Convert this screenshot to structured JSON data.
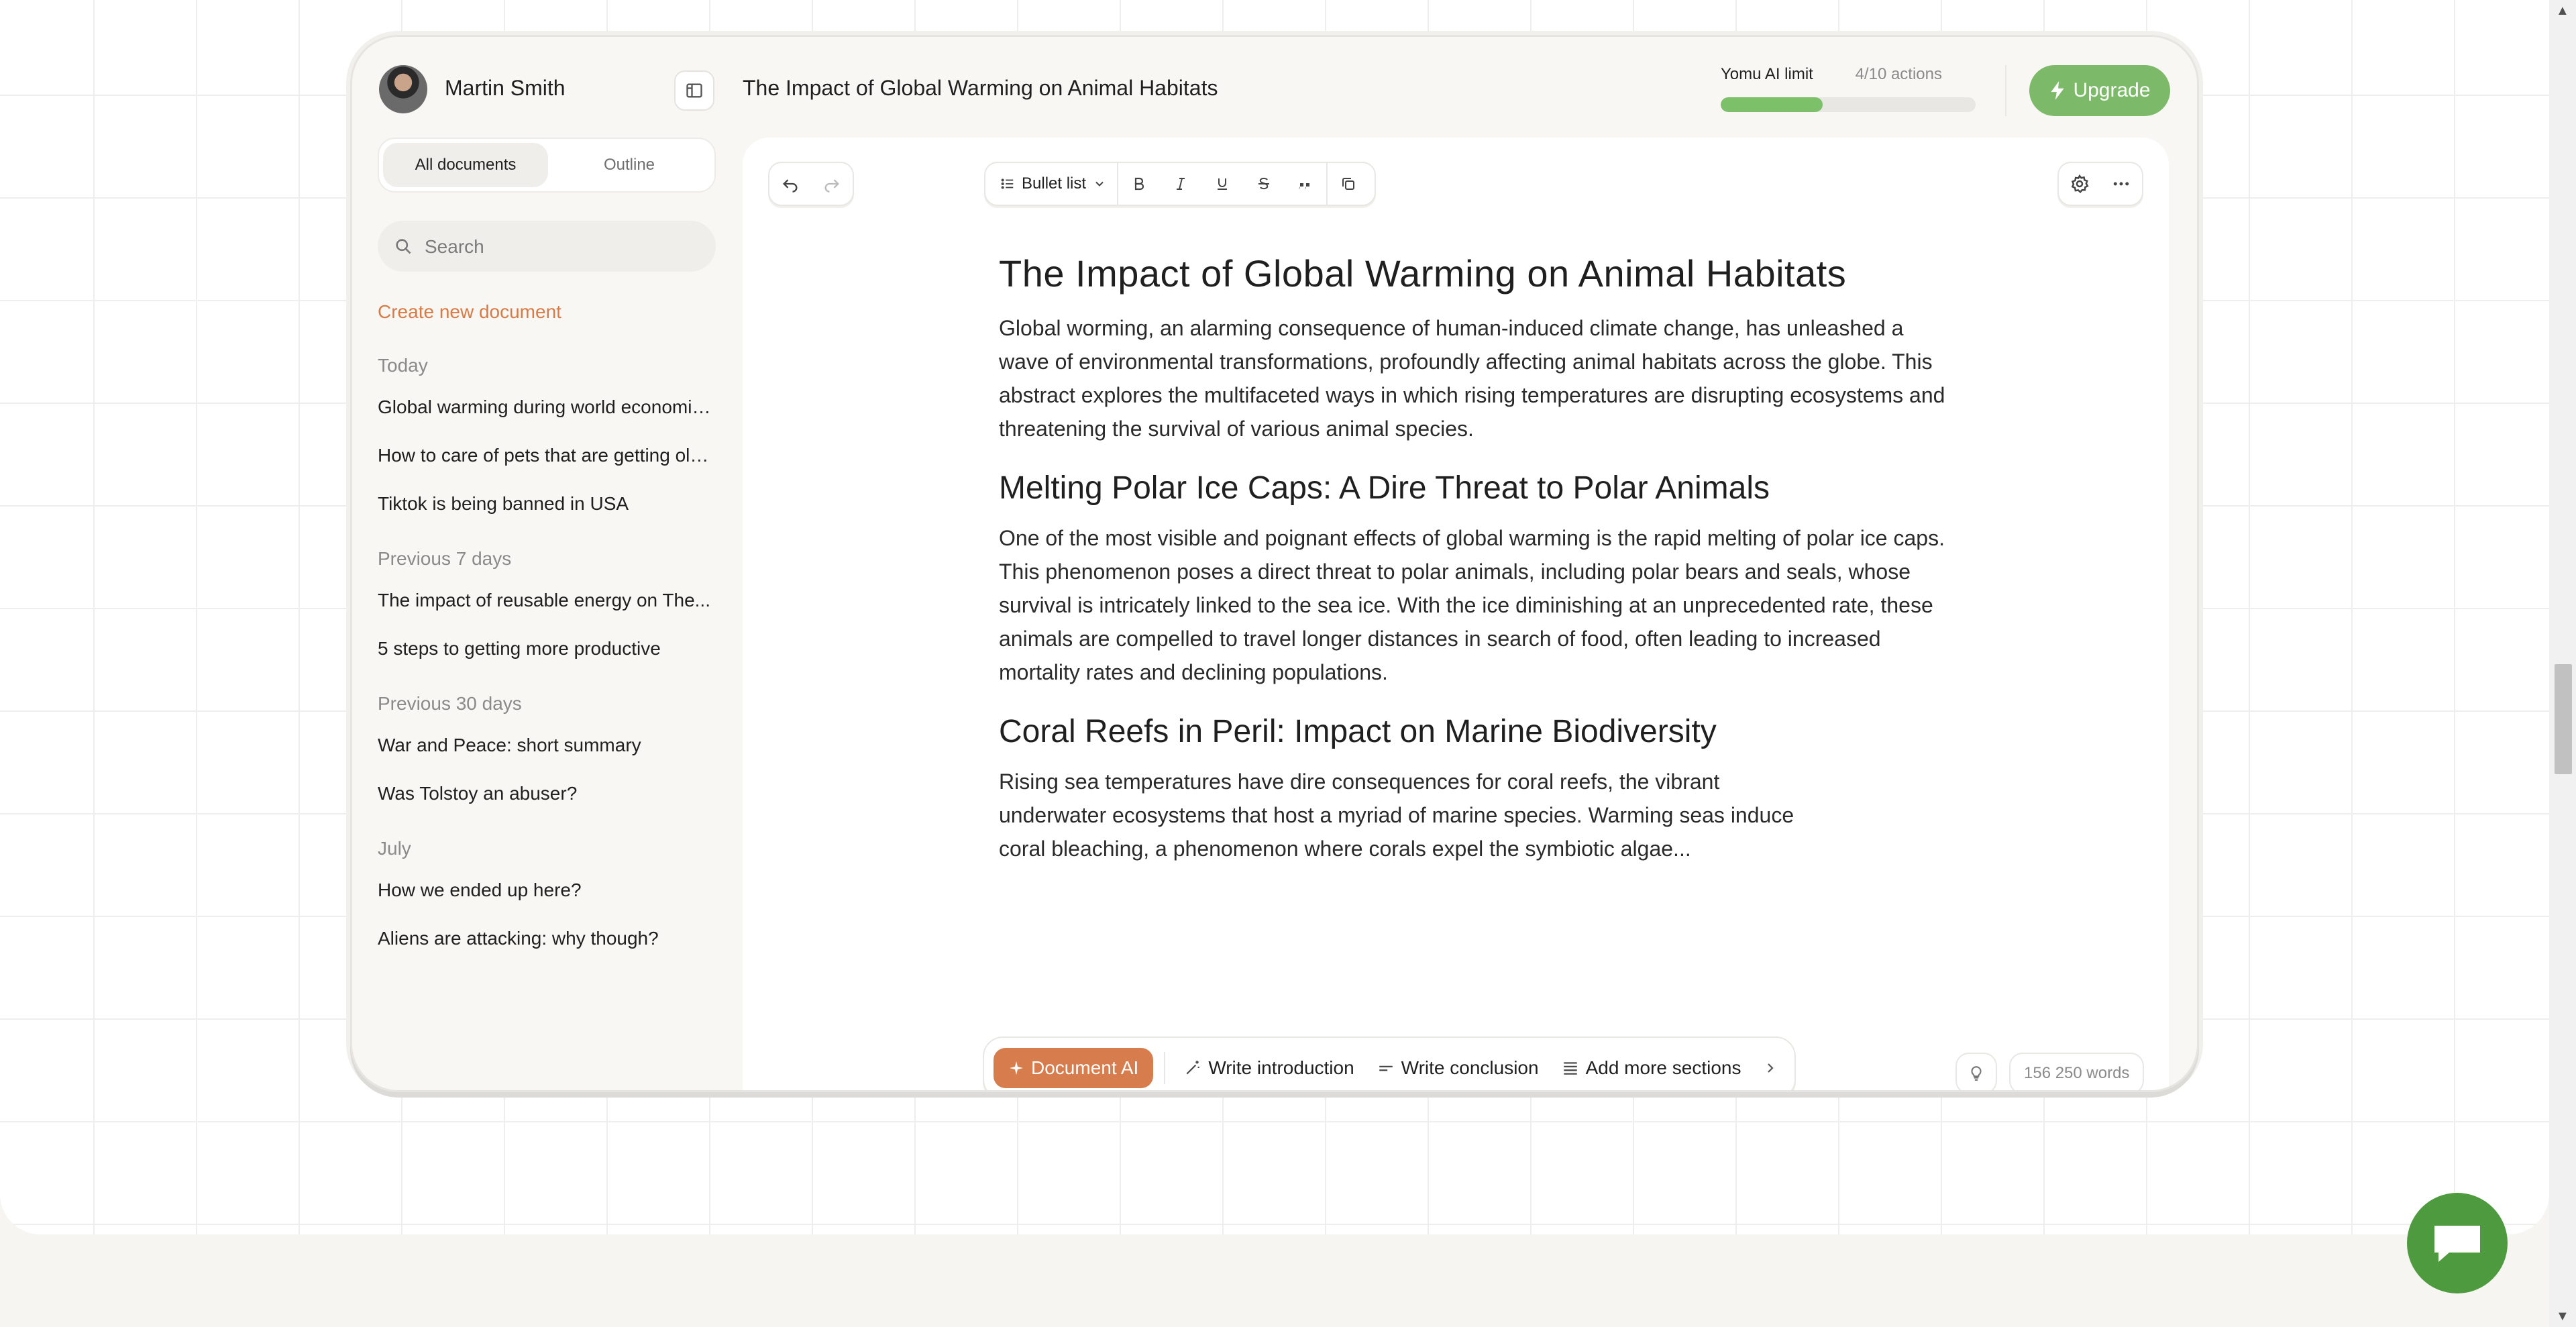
{
  "user": {
    "name": "Martin Smith"
  },
  "document": {
    "title": "The Impact of Global Warming on Animal Habitats"
  },
  "limit": {
    "label": "Yomu AI limit",
    "count": "4/10 actions",
    "used": 4,
    "total": 10
  },
  "upgrade": {
    "label": "Upgrade"
  },
  "sidebar": {
    "tabs": {
      "all": "All documents",
      "outline": "Outline"
    },
    "search_placeholder": "Search",
    "create_label": "Create new document",
    "groups": [
      {
        "label": "Today",
        "items": [
          "Global warming during world economic...",
          "How to care of pets that are getting old...",
          "Tiktok is being banned in USA"
        ]
      },
      {
        "label": "Previous 7 days",
        "items": [
          "The impact of reusable energy on The...",
          "5 steps to getting more productive"
        ]
      },
      {
        "label": "Previous 30 days",
        "items": [
          "War and Peace: short summary",
          "Was Tolstoy an abuser?"
        ]
      },
      {
        "label": "July",
        "items": [
          "How we ended up here?",
          "Aliens are attacking: why though?"
        ]
      }
    ]
  },
  "toolbar": {
    "block_type": "Bullet list"
  },
  "content": {
    "h1": "The Impact of Global Warming on Animal Habitats",
    "p1": "Global worming, an alarming consequence of human-induced climate change, has unleashed a wave of environmental transformations, profoundly affecting animal habitats across the globe. This abstract explores the multifaceted ways in which rising temperatures are disrupting ecosystems and threatening the survival of various animal species.",
    "h2a": "Melting Polar Ice Caps: A Dire Threat to Polar Animals",
    "p2": "One of the most visible and poignant effects of global warming is the rapid melting of polar ice caps. This phenomenon poses a direct threat to polar animals, including polar bears and seals, whose survival is intricately linked to the sea ice. With the ice diminishing at an unprecedented rate, these animals are compelled to travel longer distances in search of food, often leading to increased mortality rates and declining populations.",
    "h2b": "Coral Reefs in Peril: Impact on Marine Biodiversity",
    "p3": "Rising sea temperatures have dire consequences for coral reefs, the vibrant underwater ecosystems that host a myriad of marine species. Warming seas induce coral bleaching, a phenomenon where corals expel the symbiotic algae..."
  },
  "ai_bar": {
    "main": "Document AI",
    "actions": [
      "Write introduction",
      "Write conclusion",
      "Add more sections"
    ]
  },
  "word_count": "156 250 words",
  "colors": {
    "accent_orange": "#d77c4c",
    "accent_green": "#7cba6a",
    "chat_green": "#4e9a3f"
  }
}
